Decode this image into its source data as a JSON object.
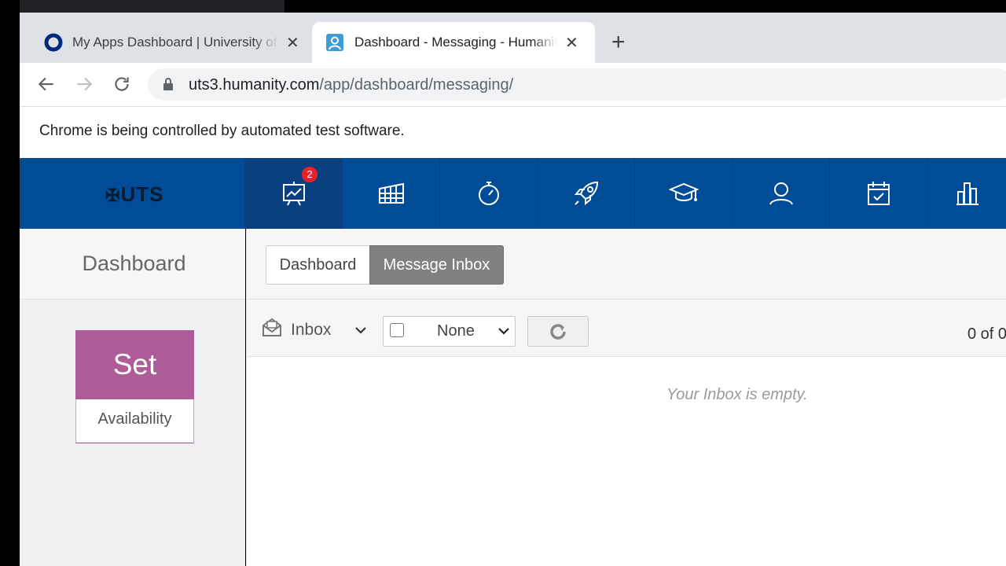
{
  "browser": {
    "tabs": [
      {
        "title": "My Apps Dashboard | University of Technology Sydney",
        "icon": "okta-ring-icon"
      },
      {
        "title": "Dashboard - Messaging - Humanity",
        "icon": "humanity-user-icon"
      }
    ],
    "new_tab_label": "+",
    "close_label": "✕",
    "url_host": "uts3.humanity.com",
    "url_path": "/app/dashboard/messaging/",
    "infobar_text": "Chrome is being controlled by automated test software."
  },
  "app": {
    "logo_text": "UTS",
    "nav": [
      {
        "name": "dashboard",
        "icon": "chart-board-icon",
        "badge": "2"
      },
      {
        "name": "shiftplanning",
        "icon": "grid-icon"
      },
      {
        "name": "timeclock",
        "icon": "stopwatch-icon"
      },
      {
        "name": "leave",
        "icon": "rocket-icon"
      },
      {
        "name": "training",
        "icon": "graduation-cap-icon"
      },
      {
        "name": "staff",
        "icon": "user-icon"
      },
      {
        "name": "availability",
        "icon": "calendar-check-icon"
      },
      {
        "name": "reports",
        "icon": "bar-chart-icon"
      }
    ],
    "sidebar_title": "Dashboard",
    "tabs": {
      "dashboard": "Dashboard",
      "inbox": "Message Inbox"
    },
    "set_card": {
      "big": "Set",
      "label": "Availability"
    },
    "folder_label": "Inbox",
    "select_value": "None",
    "count_text": "0 of 0",
    "empty_text": "Your Inbox is empty."
  },
  "colors": {
    "nav_bg": "#004c97",
    "set_card": "#ad5c98",
    "badge": "#e8212d",
    "active_tab": "#818181"
  }
}
